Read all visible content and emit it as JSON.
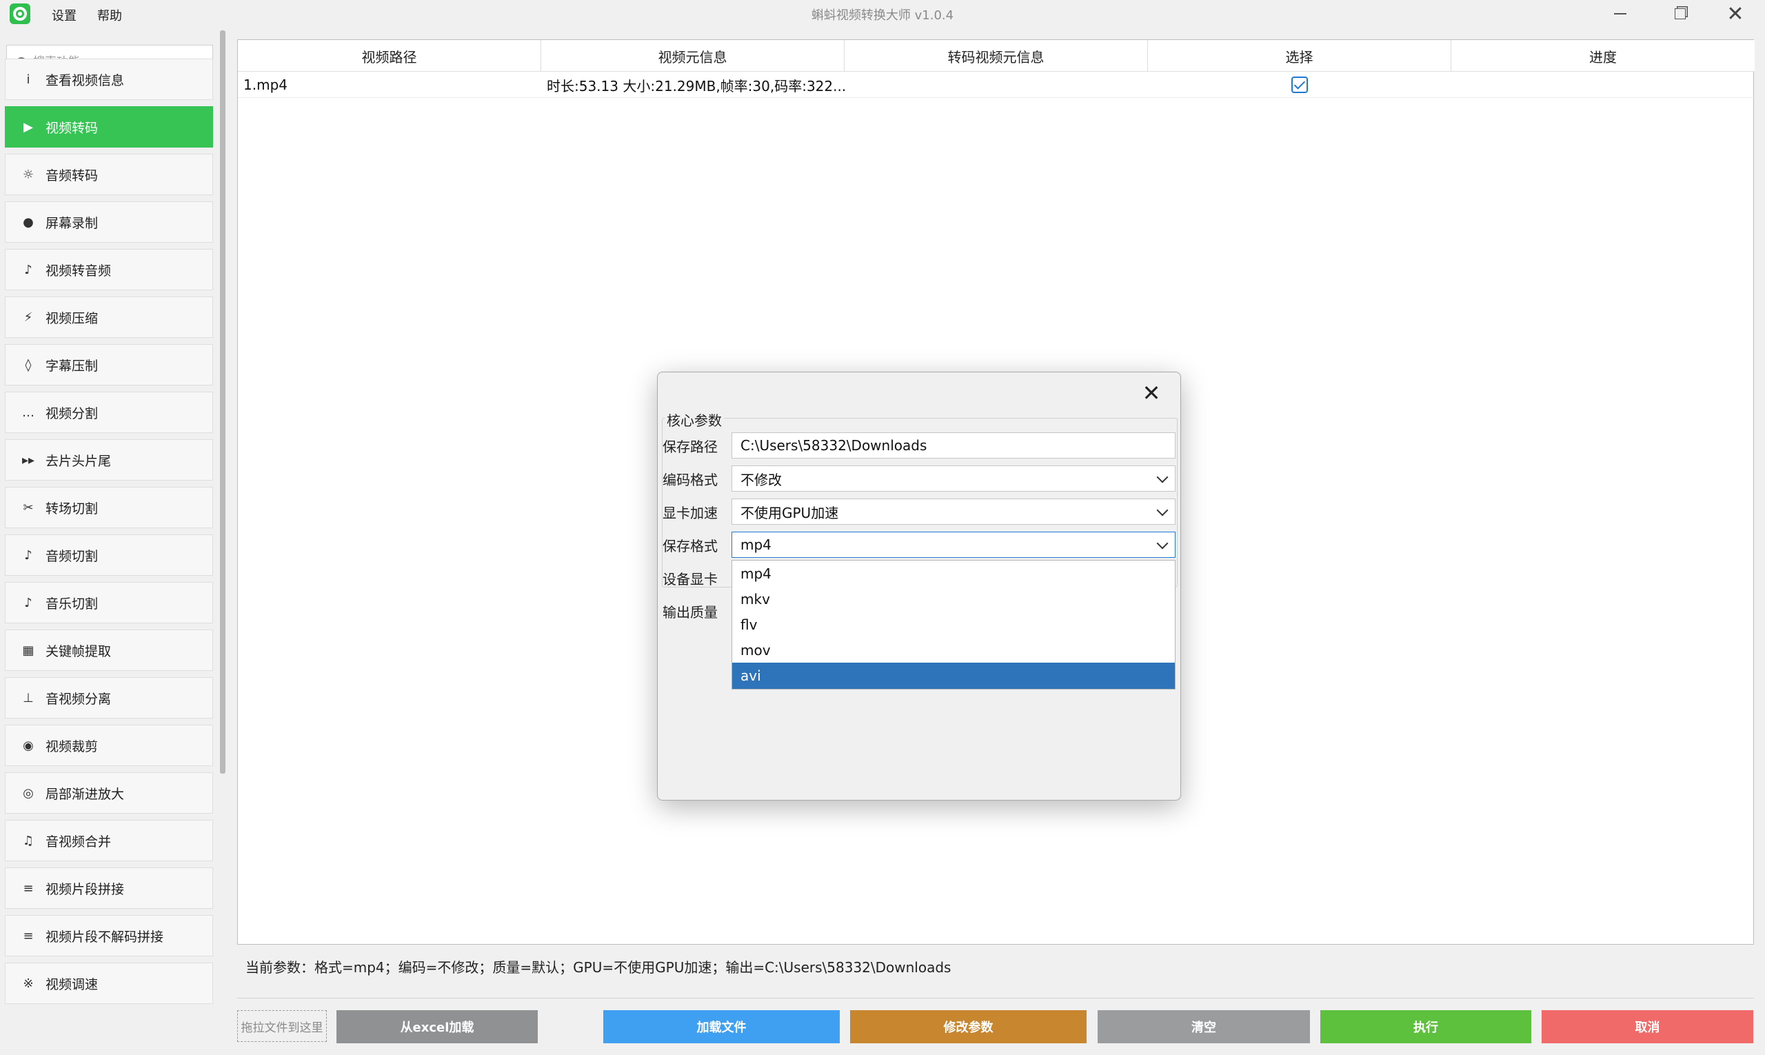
{
  "app": {
    "title": "蝌蚪视频转换大师 v1.0.4",
    "menu": [
      "设置",
      "帮助"
    ],
    "accent_color": "#37c454"
  },
  "sidebar": {
    "search_placeholder": "搜索功能...",
    "items": [
      {
        "icon": "info-icon",
        "glyph": "i",
        "label": "查看视频信息"
      },
      {
        "icon": "play-icon",
        "glyph": "▶",
        "label": "视频转码",
        "active": true
      },
      {
        "icon": "sun-icon",
        "glyph": "☼",
        "label": "音频转码"
      },
      {
        "icon": "record-icon",
        "glyph": "●",
        "label": "屏幕录制"
      },
      {
        "icon": "music-note-icon",
        "glyph": "♪",
        "label": "视频转音频"
      },
      {
        "icon": "lightning-icon",
        "glyph": "⚡",
        "label": "视频压缩"
      },
      {
        "icon": "diamond-icon",
        "glyph": "◊",
        "label": "字幕压制"
      },
      {
        "icon": "ellipsis-icon",
        "glyph": "…",
        "label": "视频分割"
      },
      {
        "icon": "fast-forward-icon",
        "glyph": "▸▸",
        "label": "去片头片尾"
      },
      {
        "icon": "scissors-icon",
        "glyph": "✂",
        "label": "转场切割"
      },
      {
        "icon": "music-note-icon",
        "glyph": "♪",
        "label": "音频切割"
      },
      {
        "icon": "music-note-icon",
        "glyph": "♪",
        "label": "音乐切割"
      },
      {
        "icon": "grid-icon",
        "glyph": "▦",
        "label": "关键帧提取"
      },
      {
        "icon": "split-icon",
        "glyph": "⊥",
        "label": "音视频分离"
      },
      {
        "icon": "target-icon",
        "glyph": "◉",
        "label": "视频裁剪"
      },
      {
        "icon": "ring-icon",
        "glyph": "◎",
        "label": "局部渐进放大"
      },
      {
        "icon": "music-notes-icon",
        "glyph": "♫",
        "label": "音视频合并"
      },
      {
        "icon": "list-icon",
        "glyph": "≡",
        "label": "视频片段拼接"
      },
      {
        "icon": "list-icon",
        "glyph": "≡",
        "label": "视频片段不解码拼接"
      },
      {
        "icon": "speed-icon",
        "glyph": "※",
        "label": "视频调速"
      }
    ]
  },
  "table": {
    "headers": [
      "视频路径",
      "视频元信息",
      "转码视频元信息",
      "选择",
      "进度"
    ],
    "rows": [
      {
        "path": "1.mp4",
        "meta": "时长:53.13 大小:21.29MB,帧率:30,码率:322...",
        "out_meta": "",
        "selected": true,
        "progress": ""
      }
    ]
  },
  "status": "当前参数：格式=mp4；编码=不修改；质量=默认；GPU=不使用GPU加速；输出=C:\\Users\\58332\\Downloads",
  "drop_hint": "拖拉文件到这里",
  "buttons": [
    {
      "name": "load-excel-button",
      "label": "从excel加载",
      "color": "#8f9193"
    },
    {
      "name": "load-file-button",
      "label": "加载文件",
      "color": "#3f9ff1"
    },
    {
      "name": "modify-params-button",
      "label": "修改参数",
      "color": "#c8872e"
    },
    {
      "name": "clear-button",
      "label": "清空",
      "color": "#9a9c9e"
    },
    {
      "name": "execute-button",
      "label": "执行",
      "color": "#5ec13d"
    },
    {
      "name": "cancel-button",
      "label": "取消",
      "color": "#f06a6a"
    }
  ],
  "dialog": {
    "group_title": "核心参数",
    "fields": {
      "save_path": {
        "label": "保存路径",
        "value": "C:\\Users\\58332\\Downloads"
      },
      "codec": {
        "label": "编码格式",
        "value": "不修改"
      },
      "gpu": {
        "label": "显卡加速",
        "value": "不使用GPU加速"
      },
      "format": {
        "label": "保存格式",
        "value": "mp4"
      },
      "device": {
        "label": "设备显卡"
      },
      "quality": {
        "label": "输出质量"
      }
    },
    "format_options": [
      "mp4",
      "mkv",
      "flv",
      "mov",
      "avi"
    ],
    "highlighted_option": "avi"
  }
}
